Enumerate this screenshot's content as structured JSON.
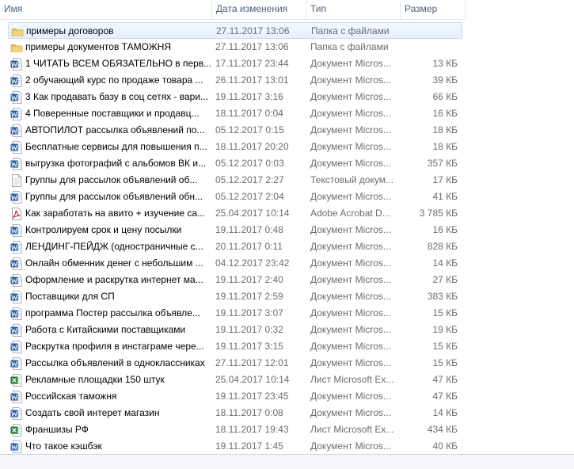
{
  "columns": {
    "name": "Имя",
    "date": "Дата изменения",
    "type": "Тип",
    "size": "Размер"
  },
  "colors": {
    "header_text": "#4c607a",
    "secondary_text": "#6d6d6d",
    "selection": "#c5dcf3"
  },
  "files": [
    {
      "icon": "folder-icon",
      "name": "примеры договоров",
      "date": "27.11.2017 13:06",
      "type": "Папка с файлами",
      "size": "",
      "selected": true
    },
    {
      "icon": "folder-icon",
      "name": "примеры документов ТАМОЖНЯ",
      "date": "27.11.2017 13:06",
      "type": "Папка с файлами",
      "size": ""
    },
    {
      "icon": "word-doc-icon",
      "name": "1 ЧИТАТЬ ВСЕМ ОБЯЗАТЕЛЬНО в перв...",
      "date": "17.11.2017 23:44",
      "type": "Документ Micros...",
      "size": "13 КБ"
    },
    {
      "icon": "word-doc-icon",
      "name": "2 обучающий курс по продаже товара ...",
      "date": "26.11.2017 13:01",
      "type": "Документ Micros...",
      "size": "39 КБ"
    },
    {
      "icon": "word-doc-icon",
      "name": "3 Как продавать базу в соц сетях - вари...",
      "date": "19.11.2017 3:16",
      "type": "Документ Micros...",
      "size": "66 КБ"
    },
    {
      "icon": "word-doc-icon",
      "name": "4 Поверенные поставщики и продавц...",
      "date": "18.11.2017 0:04",
      "type": "Документ Micros...",
      "size": "16 КБ"
    },
    {
      "icon": "word-doc-icon",
      "name": "АВТОПИЛОТ рассылка объявлений по...",
      "date": "05.12.2017 0:15",
      "type": "Документ Micros...",
      "size": "18 КБ"
    },
    {
      "icon": "word-doc-icon",
      "name": "Бесплатные сервисы для повышения п...",
      "date": "18.11.2017 20:20",
      "type": "Документ Micros...",
      "size": "18 КБ"
    },
    {
      "icon": "word-doc-icon",
      "name": "выгрузка фотографий с альбомов ВК и...",
      "date": "05.12.2017 0:03",
      "type": "Документ Micros...",
      "size": "357 КБ"
    },
    {
      "icon": "text-doc-icon",
      "name": "Группы для рассылок объявлений об...",
      "date": "05.12.2017 2:27",
      "type": "Текстовый докум...",
      "size": "17 КБ"
    },
    {
      "icon": "word-doc-icon",
      "name": "Группы для рассылок объявлений обн...",
      "date": "05.12.2017 2:04",
      "type": "Документ Micros...",
      "size": "41 КБ"
    },
    {
      "icon": "pdf-icon",
      "name": "Как заработать на авито + изучение са...",
      "date": "25.04.2017 10:14",
      "type": "Adobe Acrobat D...",
      "size": "3 785 КБ"
    },
    {
      "icon": "word-doc-icon",
      "name": "Контролируем срок и цену посылки",
      "date": "19.11.2017 0:48",
      "type": "Документ Micros...",
      "size": "16 КБ"
    },
    {
      "icon": "word-doc-icon",
      "name": "ЛЕНДИНГ-ПЕЙДЖ (одностраничные с...",
      "date": "20.11.2017 0:11",
      "type": "Документ Micros...",
      "size": "828 КБ"
    },
    {
      "icon": "word-doc-icon",
      "name": "Онлайн обменник денег с небольшим ...",
      "date": "04.12.2017 23:42",
      "type": "Документ Micros...",
      "size": "14 КБ"
    },
    {
      "icon": "word-doc-icon",
      "name": "Оформление и раскрутка интернет ма...",
      "date": "19.11.2017 2:40",
      "type": "Документ Micros...",
      "size": "27 КБ"
    },
    {
      "icon": "word-doc-icon",
      "name": "Поставщики для СП",
      "date": "19.11.2017 2:59",
      "type": "Документ Micros...",
      "size": "383 КБ"
    },
    {
      "icon": "word-doc-icon",
      "name": "программа Постер рассылка объявле...",
      "date": "19.11.2017 3:07",
      "type": "Документ Micros...",
      "size": "15 КБ"
    },
    {
      "icon": "word-doc-icon",
      "name": "Работа с Китайскими поставщиками",
      "date": "19.11.2017 0:32",
      "type": "Документ Micros...",
      "size": "19 КБ"
    },
    {
      "icon": "word-doc-icon",
      "name": "Раскрутка профиля в инстаграме чере...",
      "date": "19.11.2017 3:15",
      "type": "Документ Micros...",
      "size": "15 КБ"
    },
    {
      "icon": "word-doc-icon",
      "name": "Рассылка объявлений в одноклассниках",
      "date": "27.11.2017 12:01",
      "type": "Документ Micros...",
      "size": "15 КБ"
    },
    {
      "icon": "excel-icon",
      "name": "Рекламные площадки 150 штук",
      "date": "25.04.2017 10:14",
      "type": "Лист Microsoft Ex...",
      "size": "47 КБ"
    },
    {
      "icon": "word-doc-icon",
      "name": "Российская таможня",
      "date": "19.11.2017 23:45",
      "type": "Документ Micros...",
      "size": "47 КБ"
    },
    {
      "icon": "word-doc-icon",
      "name": "Создать свой интерет магазин",
      "date": "18.11.2017 0:08",
      "type": "Документ Micros...",
      "size": "14 КБ"
    },
    {
      "icon": "excel-icon",
      "name": "Франшизы РФ",
      "date": "18.11.2017 19:43",
      "type": "Лист Microsoft Ex...",
      "size": "434 КБ"
    },
    {
      "icon": "word-doc-icon",
      "name": "Что такое кэшбэк",
      "date": "19.11.2017 1:45",
      "type": "Документ Micros...",
      "size": "40 КБ"
    }
  ]
}
